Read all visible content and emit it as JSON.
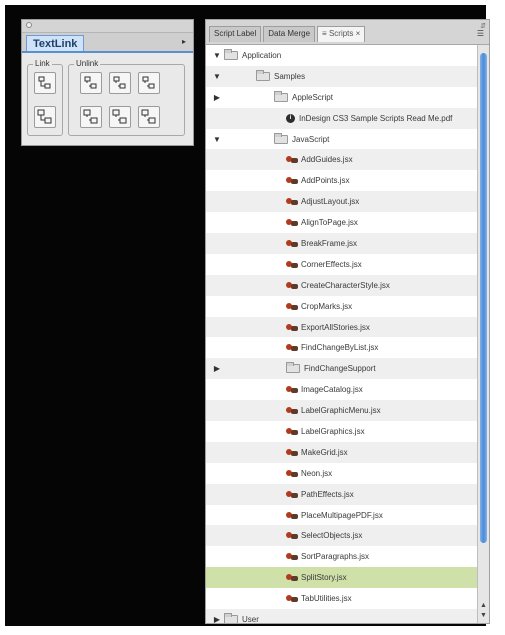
{
  "textlink": {
    "tab": "TextLink",
    "menu_icon": "panel-menu-icon",
    "link_label": "Link",
    "unlink_label": "Unlink"
  },
  "scripts_panel": {
    "tabs": [
      "Script Label",
      "Data Merge",
      "≡ Scripts ×"
    ],
    "menu_icon": "panel-menu-icon"
  },
  "tree": [
    {
      "label": "Application",
      "type": "folder",
      "level": 0,
      "toggle": "open"
    },
    {
      "label": "Samples",
      "type": "folder",
      "level": 1,
      "toggle": "open"
    },
    {
      "label": "AppleScript",
      "type": "folder",
      "level": 2,
      "toggle": "closed"
    },
    {
      "label": "InDesign CS3 Sample Scripts Read Me.pdf",
      "type": "info",
      "level": 3,
      "toggle": ""
    },
    {
      "label": "JavaScript",
      "type": "folder",
      "level": 2,
      "toggle": "open"
    },
    {
      "label": "AddGuides.jsx",
      "type": "jsx",
      "level": 3,
      "toggle": ""
    },
    {
      "label": "AddPoints.jsx",
      "type": "jsx",
      "level": 3,
      "toggle": ""
    },
    {
      "label": "AdjustLayout.jsx",
      "type": "jsx",
      "level": 3,
      "toggle": ""
    },
    {
      "label": "AlignToPage.jsx",
      "type": "jsx",
      "level": 3,
      "toggle": ""
    },
    {
      "label": "BreakFrame.jsx",
      "type": "jsx",
      "level": 3,
      "toggle": ""
    },
    {
      "label": "CornerEffects.jsx",
      "type": "jsx",
      "level": 3,
      "toggle": ""
    },
    {
      "label": "CreateCharacterStyle.jsx",
      "type": "jsx",
      "level": 3,
      "toggle": ""
    },
    {
      "label": "CropMarks.jsx",
      "type": "jsx",
      "level": 3,
      "toggle": ""
    },
    {
      "label": "ExportAllStories.jsx",
      "type": "jsx",
      "level": 3,
      "toggle": ""
    },
    {
      "label": "FindChangeByList.jsx",
      "type": "jsx",
      "level": 3,
      "toggle": ""
    },
    {
      "label": "FindChangeSupport",
      "type": "folder",
      "level": 3,
      "toggle": "closed"
    },
    {
      "label": "ImageCatalog.jsx",
      "type": "jsx",
      "level": 3,
      "toggle": ""
    },
    {
      "label": "LabelGraphicMenu.jsx",
      "type": "jsx",
      "level": 3,
      "toggle": ""
    },
    {
      "label": "LabelGraphics.jsx",
      "type": "jsx",
      "level": 3,
      "toggle": ""
    },
    {
      "label": "MakeGrid.jsx",
      "type": "jsx",
      "level": 3,
      "toggle": ""
    },
    {
      "label": "Neon.jsx",
      "type": "jsx",
      "level": 3,
      "toggle": ""
    },
    {
      "label": "PathEffects.jsx",
      "type": "jsx",
      "level": 3,
      "toggle": ""
    },
    {
      "label": "PlaceMultipagePDF.jsx",
      "type": "jsx",
      "level": 3,
      "toggle": ""
    },
    {
      "label": "SelectObjects.jsx",
      "type": "jsx",
      "level": 3,
      "toggle": ""
    },
    {
      "label": "SortParagraphs.jsx",
      "type": "jsx",
      "level": 3,
      "toggle": ""
    },
    {
      "label": "SplitStory.jsx",
      "type": "jsx",
      "level": 3,
      "toggle": "",
      "selected": true
    },
    {
      "label": "TabUtilities.jsx",
      "type": "jsx",
      "level": 3,
      "toggle": ""
    },
    {
      "label": "User",
      "type": "folder",
      "level": 0,
      "toggle": "closed"
    }
  ],
  "colors": {
    "selection": "#cfe0a8",
    "accent": "#5a8fd0"
  }
}
